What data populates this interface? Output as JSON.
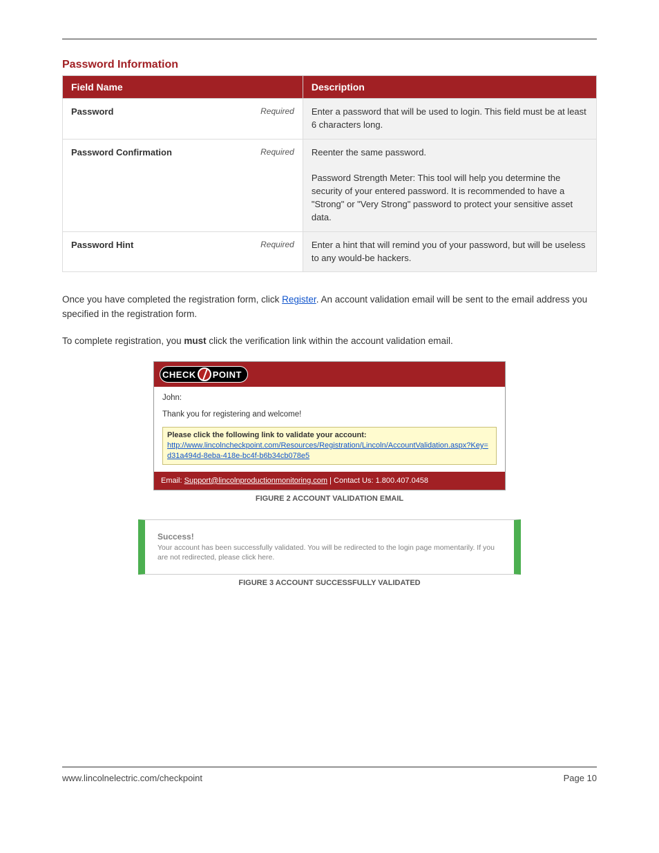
{
  "header": {
    "section_title": "Password Information"
  },
  "table": {
    "columns": [
      "Field Name",
      "Description"
    ],
    "rows": [
      {
        "name": "Password",
        "required": "Required",
        "desc": "Enter a password that will be used to login. This field must be at least 6 characters long."
      },
      {
        "name": "Password Confirmation",
        "required": "Required",
        "desc": "Reenter the same password.\n\nPassword Strength Meter: This tool will help you determine the security of your entered password. It is recommended to have a \"Strong\" or \"Very Strong\" password to protect your sensitive asset data."
      },
      {
        "name": "Password Hint",
        "required": "Required",
        "desc": "Enter a hint that will remind you of your password, but will be useless to any would-be hackers."
      }
    ]
  },
  "body": {
    "p1_a": "Once you have completed the registration form, click ",
    "p1_b": ". An account validation email will be sent to the email address you specified in the registration form.",
    "p2_prefix": "To complete registration, you ",
    "p2_bold": "must",
    "p2_suffix": " click the verification link within the account validation email.",
    "register_link": "Register"
  },
  "email": {
    "logo_left": "CHECK",
    "logo_right": "POINT",
    "greeting": "John:",
    "thanks": "Thank you for registering and welcome!",
    "callout_bold": "Please click the following link to validate your account:",
    "callout_link": "http://www.lincolncheckpoint.com/Resources/Registration/Lincoln/AccountValidation.aspx?Key=d31a494d-8eba-418e-bc4f-b6b34cb078e5",
    "footer_prefix": "Email: ",
    "footer_email": "Support@lincolnproductionmonitoring.com",
    "footer_sep": " | Contact Us: ",
    "footer_phone": "1.800.407.0458"
  },
  "fig1_caption": "FIGURE 2 ACCOUNT VALIDATION EMAIL",
  "greenbox": {
    "success": "Success!",
    "msg": "Your account has been successfully validated. You will be redirected to the login page momentarily. If you are not redirected, please click here."
  },
  "fig2_caption": "FIGURE 3 ACCOUNT SUCCESSFULLY VALIDATED",
  "footer": {
    "left": "www.lincolnelectric.com/checkpoint",
    "right": "Page 10"
  }
}
